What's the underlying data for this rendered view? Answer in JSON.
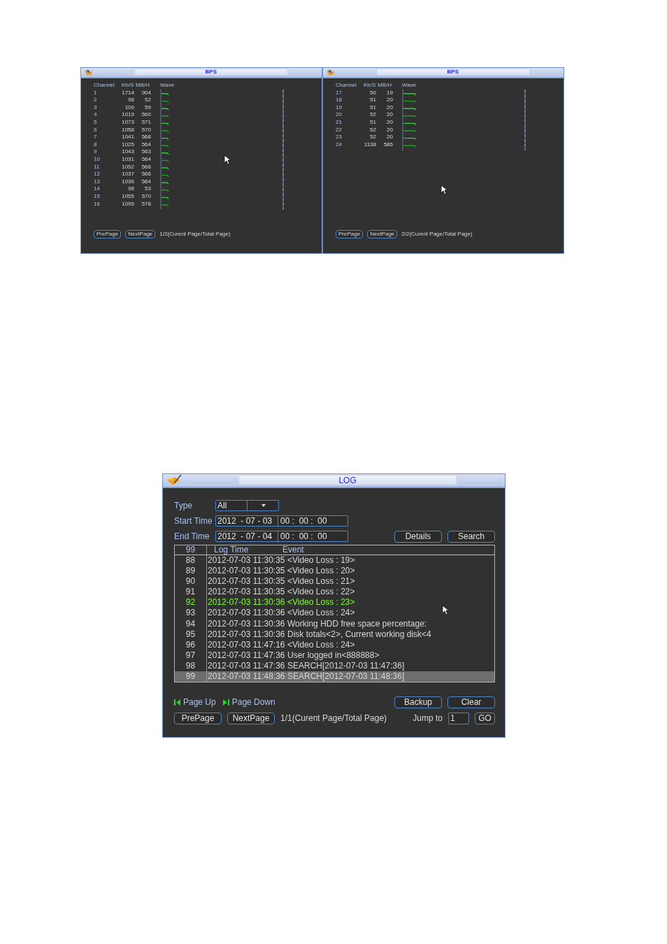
{
  "bps_windows": [
    {
      "title": "BPS",
      "columns": [
        "Channel",
        "Kb/S",
        "MB/H",
        "Wave"
      ],
      "rows": [
        {
          "channel": "1",
          "kbps": "1714",
          "mbh": "904"
        },
        {
          "channel": "2",
          "kbps": "98",
          "mbh": "52"
        },
        {
          "channel": "3",
          "kbps": "109",
          "mbh": "59"
        },
        {
          "channel": "4",
          "kbps": "1019",
          "mbh": "560"
        },
        {
          "channel": "5",
          "kbps": "1073",
          "mbh": "571"
        },
        {
          "channel": "6",
          "kbps": "1058",
          "mbh": "570"
        },
        {
          "channel": "7",
          "kbps": "1041",
          "mbh": "568"
        },
        {
          "channel": "8",
          "kbps": "1025",
          "mbh": "564"
        },
        {
          "channel": "9",
          "kbps": "1043",
          "mbh": "563"
        },
        {
          "channel": "10",
          "kbps": "1031",
          "mbh": "564"
        },
        {
          "channel": "11",
          "kbps": "1052",
          "mbh": "566"
        },
        {
          "channel": "12",
          "kbps": "1037",
          "mbh": "566"
        },
        {
          "channel": "13",
          "kbps": "1036",
          "mbh": "564"
        },
        {
          "channel": "14",
          "kbps": "98",
          "mbh": "53"
        },
        {
          "channel": "15",
          "kbps": "1055",
          "mbh": "570"
        },
        {
          "channel": "16",
          "kbps": "1095",
          "mbh": "578"
        }
      ],
      "buttons": [
        "PrePage",
        "NextPage"
      ],
      "page_info": "1/2(Curent Page/Total Page)"
    },
    {
      "title": "BPS",
      "columns": [
        "Channel",
        "Kb/S",
        "MB/H",
        "Wave"
      ],
      "rows": [
        {
          "channel": "17",
          "kbps": "50",
          "mbh": "19"
        },
        {
          "channel": "18",
          "kbps": "51",
          "mbh": "20"
        },
        {
          "channel": "19",
          "kbps": "51",
          "mbh": "20"
        },
        {
          "channel": "20",
          "kbps": "52",
          "mbh": "20"
        },
        {
          "channel": "21",
          "kbps": "51",
          "mbh": "20"
        },
        {
          "channel": "22",
          "kbps": "52",
          "mbh": "20"
        },
        {
          "channel": "23",
          "kbps": "52",
          "mbh": "20"
        },
        {
          "channel": "24",
          "kbps": "1138",
          "mbh": "586"
        }
      ],
      "buttons": [
        "PrePage",
        "NextPage"
      ],
      "page_info": "2/2(Curent Page/Total Page)"
    }
  ],
  "log_window": {
    "title": "LOG",
    "type": {
      "label": "Type",
      "value": "All"
    },
    "start_time": {
      "label": "Start Time",
      "date": "2012  - 07 - 03",
      "time": "00 :  00 :  00"
    },
    "end_time": {
      "label": "End Time",
      "date": "2012  - 07 - 04",
      "time": "00 :  00 :  00"
    },
    "action_buttons": [
      "Details",
      "Search"
    ],
    "table": {
      "columns": [
        "99",
        "Log Time",
        "Event"
      ],
      "rows": [
        {
          "index": "88",
          "time": "2012-07-03 11:30:35",
          "event": "<Video Loss : 19>",
          "highlighted": false,
          "selected": false
        },
        {
          "index": "89",
          "time": "2012-07-03 11:30:35",
          "event": "<Video Loss : 20>",
          "highlighted": false,
          "selected": false
        },
        {
          "index": "90",
          "time": "2012-07-03 11:30:35",
          "event": "<Video Loss : 21>",
          "highlighted": false,
          "selected": false
        },
        {
          "index": "91",
          "time": "2012-07-03 11:30:35",
          "event": "<Video Loss : 22>",
          "highlighted": false,
          "selected": false
        },
        {
          "index": "92",
          "time": "2012-07-03 11:30:36",
          "event": "<Video Loss : 23>",
          "highlighted": true,
          "selected": false
        },
        {
          "index": "93",
          "time": "2012-07-03 11:30:36",
          "event": "<Video Loss : 24>",
          "highlighted": false,
          "selected": false
        },
        {
          "index": "94",
          "time": "2012-07-03 11:30:36",
          "event": "Working HDD free space percentage:",
          "highlighted": false,
          "selected": false
        },
        {
          "index": "95",
          "time": "2012-07-03 11:30:36",
          "event": "Disk totals<2>, Current working disk<4",
          "highlighted": false,
          "selected": false
        },
        {
          "index": "96",
          "time": "2012-07-03 11:47:16",
          "event": "<Video Loss : 24>",
          "highlighted": false,
          "selected": false
        },
        {
          "index": "97",
          "time": "2012-07-03 11:47:36",
          "event": "User logged in<888888>",
          "highlighted": false,
          "selected": false
        },
        {
          "index": "98",
          "time": "2012-07-03 11:47:36",
          "event": "SEARCH[2012-07-03 11:47:36]",
          "highlighted": false,
          "selected": false
        },
        {
          "index": "99",
          "time": "2012-07-03 11:48:36",
          "event": "SEARCH[2012-07-03 11:48:36]",
          "highlighted": false,
          "selected": true
        }
      ]
    },
    "page_up": "Page Up",
    "page_down": "Page Down",
    "manage_buttons": [
      "Backup",
      "Clear"
    ],
    "page_buttons": [
      "PrePage",
      "NextPage"
    ],
    "page_info": "1/1(Curent Page/Total Page)",
    "jump": {
      "label": "Jump to",
      "value": "1",
      "button": "GO"
    }
  }
}
